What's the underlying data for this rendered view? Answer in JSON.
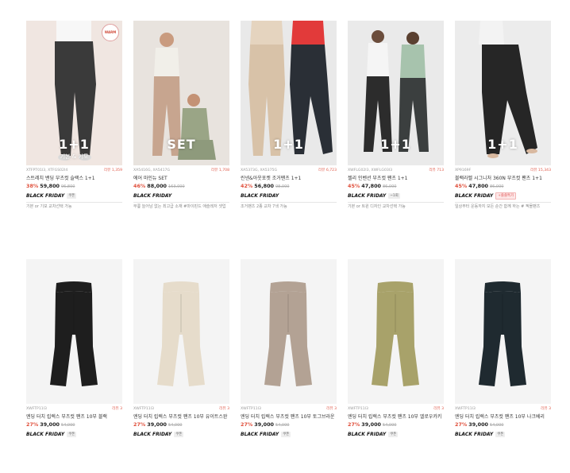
{
  "products": [
    {
      "code": "XTFPT01I3, XTFGS02I4",
      "reviews": "리뷰 1,359",
      "name": "스트레치 밴딩 부츠컷 슬랙스 1+1",
      "discount": "38%",
      "price": "59,800",
      "original": "96,800",
      "overlay_big": "1+1",
      "overlay_small": "기본 & 키모",
      "badge": "WARM",
      "tags": [
        "BLACK FRIDAY",
        "쿠폰"
      ],
      "desc": "기본 or 기모 교차선택 가능"
    },
    {
      "code": "XA5416G, XA5417G",
      "reviews": "리뷰 1,708",
      "name": "에어 마인뉴 SET",
      "discount": "46%",
      "price": "88,000",
      "original": "163,000",
      "overlay_big": "SET",
      "overlay_small": "",
      "badge": "",
      "tags": [
        "BLACK FRIDAY"
      ],
      "desc": "무릎 늘어남 없는 최고급 소재 #마이핀드 애슬레저 셋업"
    },
    {
      "code": "XA5373G, XA5375G",
      "reviews": "리뷰 6,723",
      "name": "린넨&아웃포켓 조거팬츠 1+1",
      "discount": "42%",
      "price": "56,800",
      "original": "98,000",
      "overlay_big": "1+1",
      "overlay_small": "",
      "badge": "",
      "tags": [
        "BLACK FRIDAY"
      ],
      "desc": "조거팬츠 2종 교차 7색 가능"
    },
    {
      "code": "XWFLG02I3, XWFLG03I3",
      "reviews": "리뷰 713",
      "name": "젤리 인벤션 부츠컷 팬츠 1+1",
      "discount": "45%",
      "price": "47,800",
      "original": "86,000",
      "overlay_big": "1+1",
      "overlay_small": "",
      "badge": "",
      "tags": [
        "BLACK FRIDAY",
        "~1회"
      ],
      "desc": "기본 or 트윈 디자인 교차선택 가능"
    },
    {
      "code": "XP9169F",
      "reviews": "리뷰 15,343",
      "name": "블랙라벨 시그니처 360N 부츠컷 팬츠 1+1",
      "discount": "45%",
      "price": "47,800",
      "original": "86,000",
      "overlay_big": "1+1",
      "overlay_small": "",
      "badge": "",
      "tags": [
        "BLACK FRIDAY",
        "+쏠쏠특가"
      ],
      "desc": "일상부터 운동까지 모든 순간 함께 하는 # 젝몰팬츠"
    },
    {
      "code": "XWFTP11I3",
      "reviews": "리뷰 3",
      "name": "엔딩 터치 립렉스 부츠컷 팬츠 10부 블랙",
      "discount": "27%",
      "price": "39,000",
      "original": "54,000",
      "overlay_big": "",
      "overlay_small": "",
      "badge": "",
      "tags": [
        "BLACK FRIDAY",
        "쿠폰"
      ],
      "desc": ""
    },
    {
      "code": "XWFTP11I3",
      "reviews": "리뷰 3",
      "name": "엔딩 터치 립렉스 부츠컷 팬츠 10부 유이트스완",
      "discount": "27%",
      "price": "39,000",
      "original": "54,000",
      "overlay_big": "",
      "overlay_small": "",
      "badge": "",
      "tags": [
        "BLACK FRIDAY",
        "쿠폰"
      ],
      "desc": ""
    },
    {
      "code": "XWFTP11I3",
      "reviews": "리뷰 3",
      "name": "엔딩 터치 립렉스 부츠컷 팬츠 10부 토그브라운",
      "discount": "27%",
      "price": "39,000",
      "original": "54,000",
      "overlay_big": "",
      "overlay_small": "",
      "badge": "",
      "tags": [
        "BLACK FRIDAY",
        "쿠폰"
      ],
      "desc": ""
    },
    {
      "code": "XWFTP11I3",
      "reviews": "리뷰 3",
      "name": "엔딩 터치 립렉스 부츠컷 팬츠 10부 엘로우카키",
      "discount": "27%",
      "price": "39,000",
      "original": "54,000",
      "overlay_big": "",
      "overlay_small": "",
      "badge": "",
      "tags": [
        "BLACK FRIDAY",
        "쿠폰"
      ],
      "desc": ""
    },
    {
      "code": "XWFTP11I3",
      "reviews": "리뷰 3",
      "name": "엔딩 터치 립렉스 부츠컷 팬츠 10부 나크베리",
      "discount": "27%",
      "price": "39,000",
      "original": "54,000",
      "overlay_big": "",
      "overlay_small": "",
      "badge": "",
      "tags": [
        "BLACK FRIDAY",
        "쿠폰"
      ],
      "desc": ""
    }
  ],
  "colors": {
    "discount": "#e0503c",
    "review": "#e05a4a",
    "pant_black": "#1e1e1e",
    "pant_cream": "#e6dccb",
    "pant_taupe": "#b3a294",
    "pant_khaki": "#a8a26a",
    "pant_navy": "#1f2a30",
    "photo_bg": "#efefef",
    "product_bg": "#f4f4f4"
  },
  "icons": [
    "warm-badge-icon"
  ]
}
